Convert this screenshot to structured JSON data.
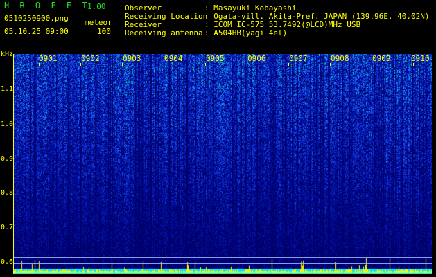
{
  "header": {
    "app_title": "H R O F F T",
    "version": "1.00",
    "filename": "0510250900.png",
    "mode": "meteor",
    "datetime": "05.10.25 09:00",
    "count": "100",
    "info": [
      {
        "label": "Observer",
        "value": ": Masayuki Kobayashi"
      },
      {
        "label": "Receiving Location",
        "value": ": Ogata-vill. Akita-Pref. JAPAN (139.96E, 40.02N)"
      },
      {
        "label": "Receiver",
        "value": ": ICOM IC-575 53.7492(@LCD)MHz USB"
      },
      {
        "label": "Receiving antenna",
        "value": ": A504HB(yagi 4el)"
      }
    ]
  },
  "axis": {
    "unit": "kHz",
    "freq_labels": [
      "1.1",
      "1.0",
      "0.9",
      "0.8",
      "0.7",
      "0.6"
    ],
    "time_labels": [
      "0901",
      "0902",
      "0903",
      "0904",
      "0905",
      "0906",
      "0907",
      "0908",
      "0909",
      "0910"
    ]
  },
  "colors": {
    "text_yellow": "#ffff00",
    "text_green": "#20e020",
    "spectrum_dark": "#00008b",
    "spectrum_mid": "#1a4dff",
    "spectrum_hot": "#00ffcc",
    "baseline_cyan": "#00e5ff"
  }
}
